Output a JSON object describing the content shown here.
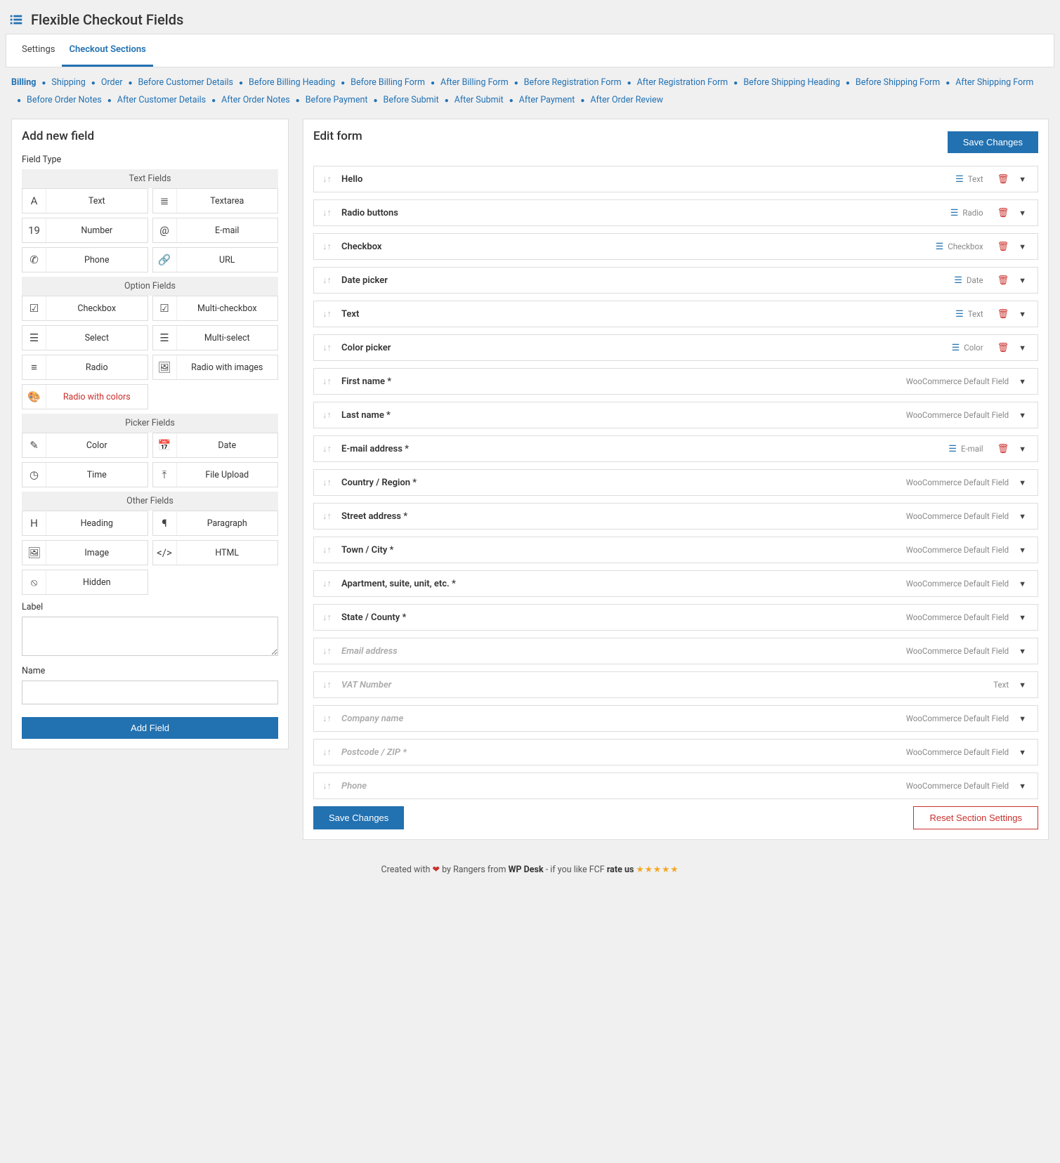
{
  "header": {
    "title": "Flexible Checkout Fields"
  },
  "tabs": {
    "settings": "Settings",
    "sections": "Checkout Sections"
  },
  "subnav": [
    "Billing",
    "Shipping",
    "Order",
    "Before Customer Details",
    "Before Billing Heading",
    "Before Billing Form",
    "After Billing Form",
    "Before Registration Form",
    "After Registration Form",
    "Before Shipping Heading",
    "Before Shipping Form",
    "After Shipping Form",
    "Before Order Notes",
    "After Customer Details",
    "After Order Notes",
    "Before Payment",
    "Before Submit",
    "After Submit",
    "After Payment",
    "After Order Review"
  ],
  "addPanel": {
    "title": "Add new field",
    "fieldTypeLabel": "Field Type",
    "groups": [
      {
        "title": "Text Fields",
        "items": [
          {
            "label": "Text",
            "icon": "A"
          },
          {
            "label": "Textarea",
            "icon": "≣"
          },
          {
            "label": "Number",
            "icon": "19"
          },
          {
            "label": "E-mail",
            "icon": "@"
          },
          {
            "label": "Phone",
            "icon": "✆"
          },
          {
            "label": "URL",
            "icon": "🔗"
          }
        ]
      },
      {
        "title": "Option Fields",
        "items": [
          {
            "label": "Checkbox",
            "icon": "☑"
          },
          {
            "label": "Multi-checkbox",
            "icon": "☑"
          },
          {
            "label": "Select",
            "icon": "☰"
          },
          {
            "label": "Multi-select",
            "icon": "☰"
          },
          {
            "label": "Radio",
            "icon": "≡"
          },
          {
            "label": "Radio with images",
            "icon": "🖼"
          },
          {
            "label": "Radio with colors",
            "icon": "🎨",
            "active": true
          }
        ]
      },
      {
        "title": "Picker Fields",
        "items": [
          {
            "label": "Color",
            "icon": "✎"
          },
          {
            "label": "Date",
            "icon": "📅"
          },
          {
            "label": "Time",
            "icon": "◷"
          },
          {
            "label": "File Upload",
            "icon": "⤒"
          }
        ]
      },
      {
        "title": "Other Fields",
        "items": [
          {
            "label": "Heading",
            "icon": "H"
          },
          {
            "label": "Paragraph",
            "icon": "¶"
          },
          {
            "label": "Image",
            "icon": "🖼"
          },
          {
            "label": "HTML",
            "icon": "</>"
          },
          {
            "label": "Hidden",
            "icon": "⦸"
          }
        ]
      }
    ],
    "labelLabel": "Label",
    "nameLabel": "Name",
    "addButton": "Add Field"
  },
  "editPanel": {
    "title": "Edit form",
    "saveButton": "Save Changes",
    "resetButton": "Reset Section Settings",
    "rows": [
      {
        "name": "Hello",
        "meta": "Text",
        "list": true,
        "trash": true
      },
      {
        "name": "Radio buttons",
        "meta": "Radio",
        "list": true,
        "trash": true
      },
      {
        "name": "Checkbox",
        "meta": "Checkbox",
        "list": true,
        "trash": true
      },
      {
        "name": "Date picker",
        "meta": "Date",
        "list": true,
        "trash": true
      },
      {
        "name": "Text",
        "meta": "Text",
        "list": true,
        "trash": true
      },
      {
        "name": "Color picker",
        "meta": "Color",
        "list": true,
        "trash": true
      },
      {
        "name": "First name *",
        "meta": "WooCommerce Default Field"
      },
      {
        "name": "Last name *",
        "meta": "WooCommerce Default Field"
      },
      {
        "name": "E-mail address *",
        "meta": "E-mail",
        "list": true,
        "trash": true
      },
      {
        "name": "Country / Region *",
        "meta": "WooCommerce Default Field"
      },
      {
        "name": "Street address *",
        "meta": "WooCommerce Default Field"
      },
      {
        "name": "Town / City *",
        "meta": "WooCommerce Default Field"
      },
      {
        "name": "Apartment, suite, unit, etc. *",
        "meta": "WooCommerce Default Field"
      },
      {
        "name": "State / County *",
        "meta": "WooCommerce Default Field"
      },
      {
        "name": "Email address",
        "meta": "WooCommerce Default Field",
        "disabled": true
      },
      {
        "name": "VAT Number",
        "meta": "Text",
        "disabled": true
      },
      {
        "name": "Company name",
        "meta": "WooCommerce Default Field",
        "disabled": true
      },
      {
        "name": "Postcode / ZIP *",
        "meta": "WooCommerce Default Field",
        "disabled": true
      },
      {
        "name": "Phone",
        "meta": "WooCommerce Default Field",
        "disabled": true
      }
    ]
  },
  "footer": {
    "pre": "Created with ",
    "mid": " by Rangers from ",
    "brand": "WP Desk",
    "post": " - if you like FCF ",
    "rate": "rate us "
  }
}
